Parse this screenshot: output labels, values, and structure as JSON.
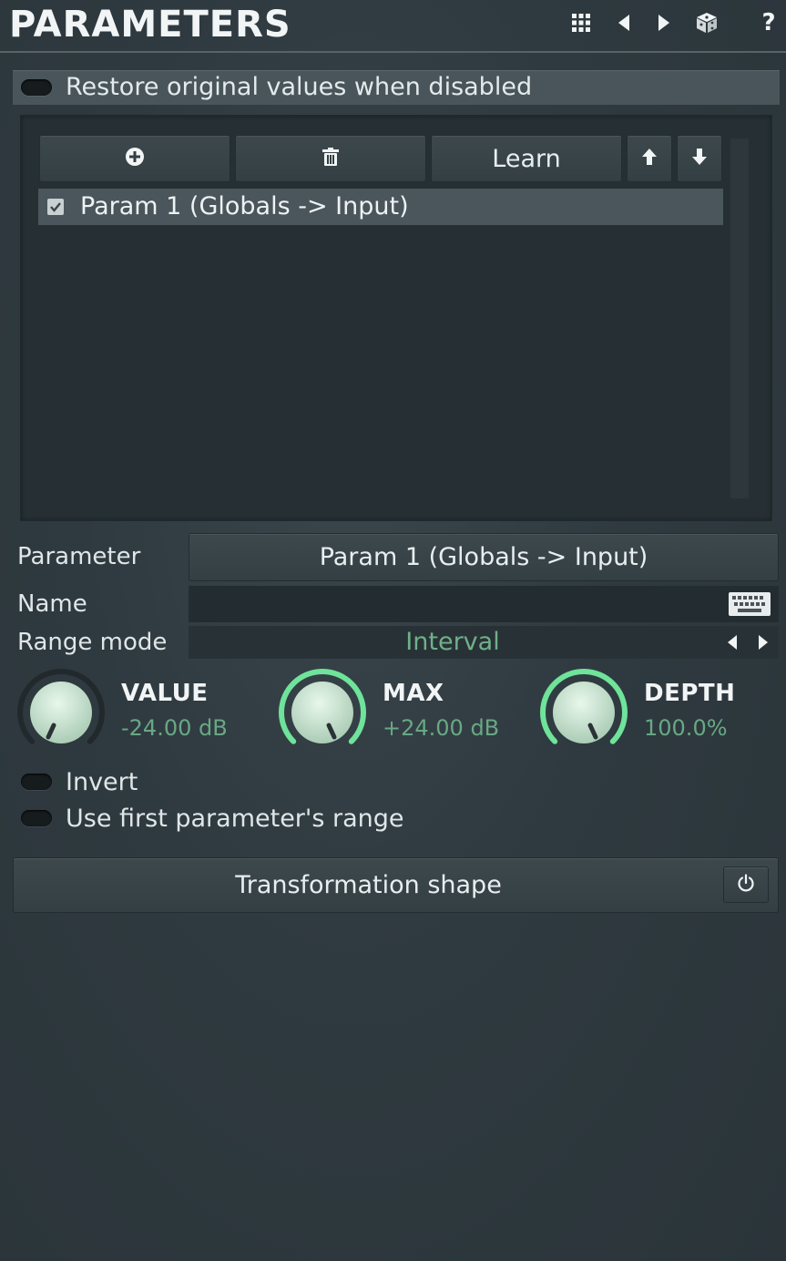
{
  "header": {
    "title": "PARAMETERS"
  },
  "restore": {
    "label": "Restore original values when disabled"
  },
  "toolbar": {
    "learn_label": "Learn"
  },
  "list": {
    "items": [
      {
        "label": "Param 1 (Globals -> Input)",
        "checked": true
      }
    ]
  },
  "form": {
    "parameter_label": "Parameter",
    "parameter_value": "Param 1 (Globals -> Input)",
    "name_label": "Name",
    "name_value": "",
    "range_mode_label": "Range mode",
    "range_mode_value": "Interval"
  },
  "knobs": [
    {
      "title": "VALUE",
      "value": "-24.00 dB",
      "level": 0.0
    },
    {
      "title": "MAX",
      "value": "+24.00 dB",
      "level": 1.0
    },
    {
      "title": "DEPTH",
      "value": "100.0%",
      "level": 1.0
    }
  ],
  "options": {
    "invert_label": "Invert",
    "first_range_label": "Use first parameter's range"
  },
  "transformation": {
    "label": "Transformation shape"
  },
  "colors": {
    "accent": "#6fe39a",
    "value_text": "#68a884",
    "background": "#2f3a40"
  }
}
